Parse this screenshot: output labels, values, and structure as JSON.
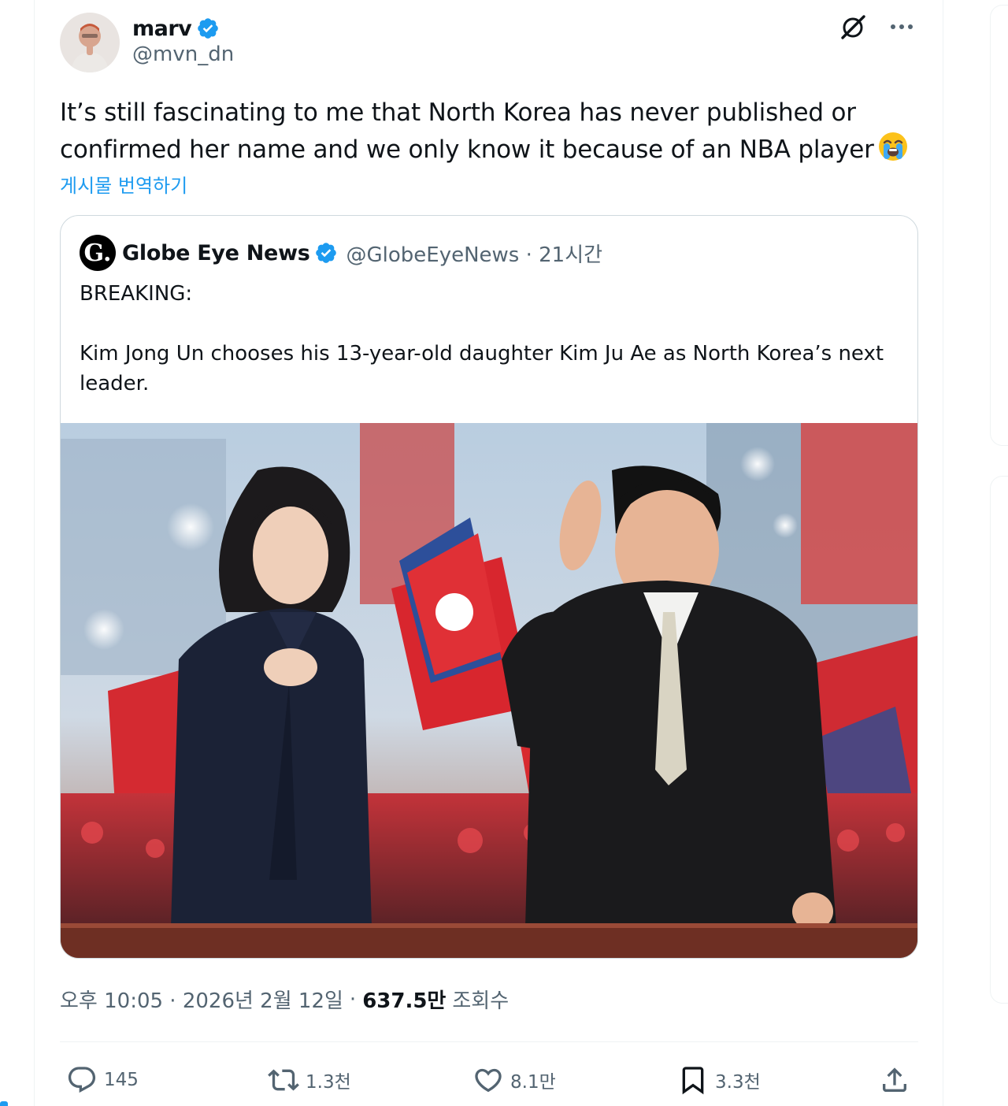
{
  "tweet": {
    "display_name": "marv",
    "handle": "@mvn_dn",
    "text": "It’s still fascinating to me that North Korea has never published or confirmed her name and we only know it because of an NBA player",
    "emoji_name": "loudly-crying-face",
    "translate_label": "게시물 번역하기",
    "timestamp": "오후 10:05 · 2026년 2월 12일",
    "separator": "·",
    "views_count": "637.5만",
    "views_label": "조회수"
  },
  "quote": {
    "logo_letter": "G.",
    "display_name": "Globe Eye News",
    "handle_time": "@GlobeEyeNews · 21시간",
    "text": "BREAKING:\n\nKim Jong Un chooses his 13-year-old daughter Kim Ju Ae as North Korea’s next leader."
  },
  "actions": {
    "reply_count": "145",
    "retweet_count": "1.3천",
    "like_count": "8.1만",
    "bookmark_count": "3.3천"
  },
  "colors": {
    "accent": "#1d9bf0",
    "secondary_text": "#536471",
    "primary_text": "#0f1419",
    "border": "#cfd9de"
  },
  "icons": [
    "verified-badge-icon",
    "grok-icon",
    "more-icon",
    "reply-icon",
    "retweet-icon",
    "like-icon",
    "bookmark-icon",
    "share-icon"
  ]
}
